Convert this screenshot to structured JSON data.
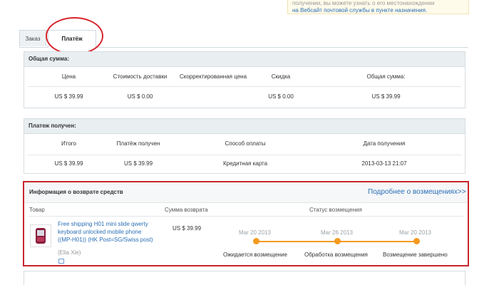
{
  "notice": {
    "line1": "получении, вы можете узнать о его местонахождении",
    "link_text": "на Вебсайт почтовой службы в пункте назначения."
  },
  "tabs": [
    {
      "label": "Заказ"
    },
    {
      "label": "Платёж"
    }
  ],
  "total": {
    "title": "Общая сумма:",
    "headers": [
      "Цена",
      "Стоимость доставки",
      "Скорректированная цена",
      "Скидка",
      "Общая сумма:"
    ],
    "values": [
      "US $ 39.99",
      "US $ 0.00",
      "",
      "US $ 0.00",
      "US $ 39.99"
    ]
  },
  "received": {
    "title": "Платеж получен:",
    "headers": [
      "Итого",
      "Платёж получен",
      "Способ оплаты",
      "Дата получения"
    ],
    "values": [
      "US $ 39.99",
      "US $ 39.99",
      "Кредитная карта",
      "2013-03-13 21:07"
    ]
  },
  "refund": {
    "title": "Информация о возврате средств",
    "more_link": "Подробнее о возмещениях>>",
    "headers": {
      "product": "Товар",
      "amount": "Сумма возврата",
      "status": "Статус возмещения"
    },
    "product_name": "Free shipping H01 mini slide qwerty keyboard unlocked mobile phone ((MP-H01)) (HK Post=SG/Swiss post)",
    "product_name_lines": [
      "Free shipping H01 mini slide qwerty",
      "keyboard unlocked mobile phone",
      "((MP-H01)) (HK Post=SG/Swiss post)"
    ],
    "seller": "(Elia Xie)",
    "amount": "US $ 39.99",
    "steps": [
      {
        "date": "Mar 20 2013",
        "label": "Ожидается возмещение"
      },
      {
        "date": "Mar 26 2013",
        "label": "Обработка возмещения"
      },
      {
        "date": "Mar 20 2013",
        "label": "Возмещение завершено"
      }
    ],
    "accent_color": "#f39a1e",
    "highlight_color": "#c9252e"
  }
}
